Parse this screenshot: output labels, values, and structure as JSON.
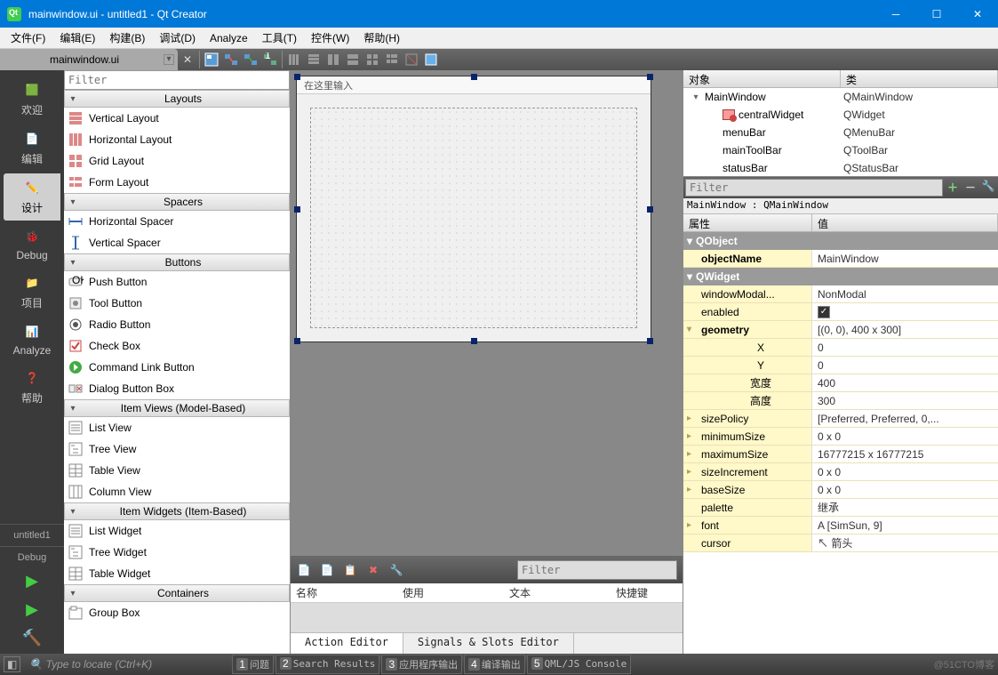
{
  "titlebar": {
    "text": "mainwindow.ui - untitled1 - Qt Creator"
  },
  "menubar": [
    "文件(F)",
    "编辑(E)",
    "构建(B)",
    "调试(D)",
    "Analyze",
    "工具(T)",
    "控件(W)",
    "帮助(H)"
  ],
  "open_tab": "mainwindow.ui",
  "left_modes": [
    {
      "label": "欢迎",
      "active": false
    },
    {
      "label": "编辑",
      "active": false
    },
    {
      "label": "设计",
      "active": true
    },
    {
      "label": "Debug",
      "active": false
    },
    {
      "label": "项目",
      "active": false
    },
    {
      "label": "Analyze",
      "active": false
    },
    {
      "label": "帮助",
      "active": false
    }
  ],
  "project_label": "untitled1",
  "target_label": "Debug",
  "widgetbox": {
    "filter_placeholder": "Filter",
    "groups": [
      {
        "title": "Layouts",
        "items": [
          {
            "label": "Vertical Layout",
            "icon": "layout-v"
          },
          {
            "label": "Horizontal Layout",
            "icon": "layout-h"
          },
          {
            "label": "Grid Layout",
            "icon": "layout-grid"
          },
          {
            "label": "Form Layout",
            "icon": "layout-form"
          }
        ]
      },
      {
        "title": "Spacers",
        "items": [
          {
            "label": "Horizontal Spacer",
            "icon": "spacer-h"
          },
          {
            "label": "Vertical Spacer",
            "icon": "spacer-v"
          }
        ]
      },
      {
        "title": "Buttons",
        "items": [
          {
            "label": "Push Button",
            "icon": "pushbtn"
          },
          {
            "label": "Tool Button",
            "icon": "toolbtn"
          },
          {
            "label": "Radio Button",
            "icon": "radio"
          },
          {
            "label": "Check Box",
            "icon": "checkbox"
          },
          {
            "label": "Command Link Button",
            "icon": "cmdlink"
          },
          {
            "label": "Dialog Button Box",
            "icon": "dlgbox"
          }
        ]
      },
      {
        "title": "Item Views (Model-Based)",
        "items": [
          {
            "label": "List View",
            "icon": "listview"
          },
          {
            "label": "Tree View",
            "icon": "treeview"
          },
          {
            "label": "Table View",
            "icon": "tableview"
          },
          {
            "label": "Column View",
            "icon": "colview"
          }
        ]
      },
      {
        "title": "Item Widgets (Item-Based)",
        "items": [
          {
            "label": "List Widget",
            "icon": "listview"
          },
          {
            "label": "Tree Widget",
            "icon": "treeview"
          },
          {
            "label": "Table Widget",
            "icon": "tableview"
          }
        ]
      },
      {
        "title": "Containers",
        "items": [
          {
            "label": "Group Box",
            "icon": "groupbox"
          }
        ]
      }
    ]
  },
  "canvas": {
    "menu_placeholder": "在这里输入"
  },
  "action_editor": {
    "filter_placeholder": "Filter",
    "headers": [
      "名称",
      "使用",
      "文本",
      "快捷键"
    ],
    "tabs": [
      "Action Editor",
      "Signals & Slots Editor"
    ],
    "active_tab": 0
  },
  "object_inspector": {
    "headers": [
      "对象",
      "类"
    ],
    "rows": [
      {
        "indent": 0,
        "exp": "v",
        "name": "MainWindow",
        "cls": "QMainWindow",
        "icon": "window"
      },
      {
        "indent": 1,
        "exp": "",
        "name": "centralWidget",
        "cls": "QWidget",
        "icon": "widget"
      },
      {
        "indent": 1,
        "exp": "",
        "name": "menuBar",
        "cls": "QMenuBar",
        "icon": ""
      },
      {
        "indent": 1,
        "exp": "",
        "name": "mainToolBar",
        "cls": "QToolBar",
        "icon": ""
      },
      {
        "indent": 1,
        "exp": "",
        "name": "statusBar",
        "cls": "QStatusBar",
        "icon": ""
      }
    ]
  },
  "property_editor": {
    "filter_placeholder": "Filter",
    "class_path": "MainWindow : QMainWindow",
    "headers": [
      "属性",
      "值"
    ],
    "groups": [
      {
        "name": "QObject",
        "rows": [
          {
            "name": "objectName",
            "value": "MainWindow",
            "bold": true
          }
        ]
      },
      {
        "name": "QWidget",
        "rows": [
          {
            "name": "windowModal...",
            "value": "NonModal"
          },
          {
            "name": "enabled",
            "value": "✓",
            "check": true
          },
          {
            "name": "geometry",
            "value": "[(0, 0), 400 x 300]",
            "exp": "v",
            "bold": true,
            "children": [
              {
                "name": "X",
                "value": "0"
              },
              {
                "name": "Y",
                "value": "0"
              },
              {
                "name": "宽度",
                "value": "400"
              },
              {
                "name": "高度",
                "value": "300"
              }
            ]
          },
          {
            "name": "sizePolicy",
            "value": "[Preferred, Preferred, 0,...",
            "exp": ">"
          },
          {
            "name": "minimumSize",
            "value": "0 x 0",
            "exp": ">"
          },
          {
            "name": "maximumSize",
            "value": "16777215 x 16777215",
            "exp": ">"
          },
          {
            "name": "sizeIncrement",
            "value": "0 x 0",
            "exp": ">"
          },
          {
            "name": "baseSize",
            "value": "0 x 0",
            "exp": ">"
          },
          {
            "name": "palette",
            "value": "继承"
          },
          {
            "name": "font",
            "value": "A  [SimSun, 9]",
            "exp": ">"
          },
          {
            "name": "cursor",
            "value": "↖ 箭头"
          }
        ]
      }
    ]
  },
  "statusbar": {
    "locator": "Type to locate (Ctrl+K)",
    "tabs": [
      "问题",
      "Search Results",
      "应用程序输出",
      "编译输出",
      "QML/JS Console"
    ],
    "watermark": "@51CTO博客"
  }
}
